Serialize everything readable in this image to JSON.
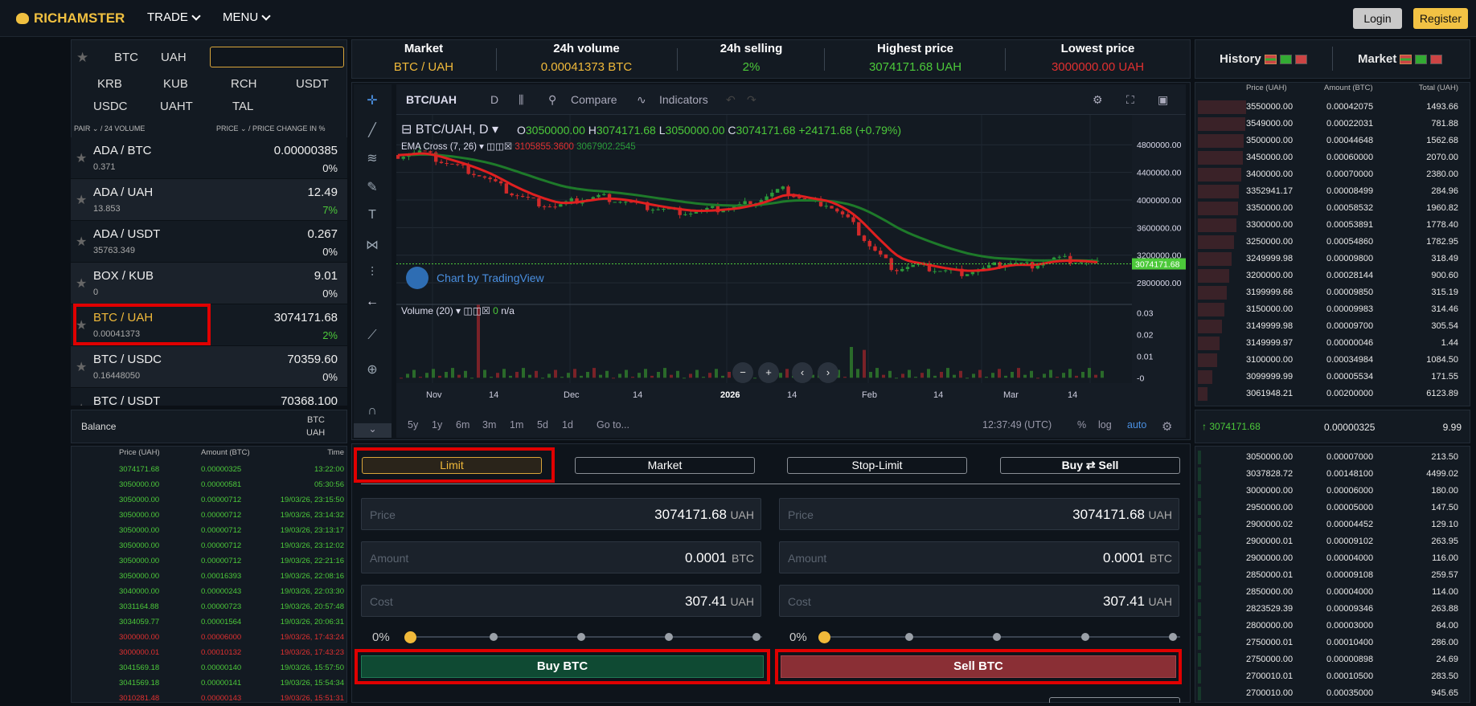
{
  "header": {
    "logo_text": "RICHAMSTER",
    "nav": [
      {
        "label": "TRADE"
      },
      {
        "label": "MENU"
      }
    ],
    "login_label": "Login",
    "register_label": "Register"
  },
  "currency_tabs": [
    "BTC",
    "UAH",
    "KRB",
    "KUB",
    "RCH",
    "USDT",
    "USDC",
    "UAHT",
    "TAL"
  ],
  "search": {
    "value": "",
    "placeholder": ""
  },
  "pairs_header": {
    "left": "PAIR ⌄ / 24 VOLUME",
    "right": "PRICE ⌄ / PRICE CHANGE IN %"
  },
  "pairs": [
    {
      "name": "ADA / BTC",
      "volume": "0.371",
      "price": "0.00000385",
      "change": "0%",
      "color": "#e8e8e8"
    },
    {
      "name": "ADA / UAH",
      "volume": "13.853",
      "price": "12.49",
      "change": "7%",
      "color": "#4cc93a"
    },
    {
      "name": "ADA / USDT",
      "volume": "35763.349",
      "price": "0.267",
      "change": "0%",
      "color": "#e8e8e8"
    },
    {
      "name": "BOX / KUB",
      "volume": "0",
      "price": "9.01",
      "change": "0%",
      "color": "#e8e8e8"
    },
    {
      "name": "BTC / UAH",
      "volume": "0.00041373",
      "price": "3074171.68",
      "change": "2%",
      "color": "#4cc93a"
    },
    {
      "name": "BTC / USDC",
      "volume": "0.16448050",
      "price": "70359.60",
      "change": "0%",
      "color": "#e8e8e8"
    },
    {
      "name": "BTC / USDT",
      "volume": "",
      "price": "70368.100",
      "change": "",
      "color": "#e8e8e8"
    }
  ],
  "balance": {
    "label": "Balance",
    "cur1": "BTC",
    "cur2": "UAH"
  },
  "trade_history": {
    "headers": [
      "Price (UAH)",
      "Amount (BTC)",
      "Time"
    ],
    "rows": [
      [
        "3074171.68",
        "0.00000325",
        "13:22:00",
        "g"
      ],
      [
        "3050000.00",
        "0.00000581",
        "05:30:56",
        "g"
      ],
      [
        "3050000.00",
        "0.00000712",
        "19/03/26, 23:15:50",
        "g"
      ],
      [
        "3050000.00",
        "0.00000712",
        "19/03/26, 23:14:32",
        "g"
      ],
      [
        "3050000.00",
        "0.00000712",
        "19/03/26, 23:13:17",
        "g"
      ],
      [
        "3050000.00",
        "0.00000712",
        "19/03/26, 23:12:02",
        "g"
      ],
      [
        "3050000.00",
        "0.00000712",
        "19/03/26, 22:21:16",
        "g"
      ],
      [
        "3050000.00",
        "0.00016393",
        "19/03/26, 22:08:16",
        "g"
      ],
      [
        "3040000.00",
        "0.00000243",
        "19/03/26, 22:03:30",
        "g"
      ],
      [
        "3031164.88",
        "0.00000723",
        "19/03/26, 20:57:48",
        "g"
      ],
      [
        "3034059.77",
        "0.00001564",
        "19/03/26, 20:06:31",
        "g"
      ],
      [
        "3000000.00",
        "0.00006000",
        "19/03/26, 17:43:24",
        "r"
      ],
      [
        "3000000.01",
        "0.00010132",
        "19/03/26, 17:43:23",
        "r"
      ],
      [
        "3041569.18",
        "0.00000140",
        "19/03/26, 15:57:50",
        "g"
      ],
      [
        "3041569.18",
        "0.00000141",
        "19/03/26, 15:54:34",
        "g"
      ],
      [
        "3010281.48",
        "0.00000143",
        "19/03/26, 15:51:31",
        "r"
      ]
    ]
  },
  "stats": [
    {
      "label": "Market",
      "value": "BTC / UAH",
      "color": "#f0b93a"
    },
    {
      "label": "24h volume",
      "value": "0.00041373 BTC",
      "color": "#f0b93a"
    },
    {
      "label": "24h selling",
      "value": "2%",
      "color": "#4cc93a"
    },
    {
      "label": "Highest price",
      "value": "3074171.68 UAH",
      "color": "#4cc93a"
    },
    {
      "label": "Lowest price",
      "value": "3000000.00 UAH",
      "color": "#e03030"
    }
  ],
  "chart_toolbar": {
    "symbol": "BTC/UAH",
    "interval": "D",
    "compare": "Compare",
    "indicators": "Indicators"
  },
  "chart_legend": {
    "symbol": "BTC/UAH, D",
    "open_label": "O",
    "open": "3050000.00",
    "high_label": "H",
    "high": "3074171.68",
    "low_label": "L",
    "low": "3050000.00",
    "close_label": "C",
    "close": "3074171.68",
    "change": "+24171.68 (+0.79%)",
    "ema_label": "EMA Cross (7, 26)",
    "ema1": "3105855.3600",
    "ema2": "3067902.2545",
    "watermark": "Chart by TradingView",
    "volume_label": "Volume (20)",
    "volume_val": "0",
    "volume_na": "n/a",
    "last_price": "3074171.68"
  },
  "chart_data": {
    "type": "candlestick",
    "title": "BTC/UAH, D",
    "y_ticks": [
      "4800000.00",
      "4400000.00",
      "4000000.00",
      "3600000.00",
      "3200000.00",
      "2800000.00"
    ],
    "y_tick_values": [
      4800000,
      4400000,
      4000000,
      3600000,
      3200000,
      2800000
    ],
    "ylim": [
      2580000,
      5000000
    ],
    "volume_ticks": [
      "0.03",
      "0.02",
      "0.01",
      "-0"
    ],
    "volume_tick_values": [
      0.03,
      0.02,
      0.01,
      0
    ],
    "volume_ylim": [
      -0.001,
      0.034
    ],
    "x_ticks": [
      "Nov",
      "14",
      "Dec",
      "14",
      "2026",
      "14",
      "Feb",
      "14",
      "Mar",
      "14"
    ],
    "close_approx": [
      4650000,
      4700000,
      4550000,
      4450000,
      4300000,
      4100000,
      3980000,
      3900000,
      4000000,
      4050000,
      3980000,
      3900000,
      3850000,
      3820000,
      3860000,
      3900000,
      4000000,
      4150000,
      4000000,
      3950000,
      3700000,
      3300000,
      3000000,
      3050000,
      2980000,
      2950000,
      3000000,
      3100000,
      3050000,
      3150000,
      3120000,
      3074171.68
    ],
    "last_price": 3074171.68
  },
  "chart_footer": {
    "ranges": [
      "5y",
      "1y",
      "6m",
      "3m",
      "1m",
      "5d",
      "1d"
    ],
    "goto": "Go to...",
    "time": "12:37:49 (UTC)",
    "pct": "%",
    "log": "log",
    "auto": "auto"
  },
  "order_tabs": [
    "Limit",
    "Market",
    "Stop-Limit"
  ],
  "buysell_toggle": {
    "buy": "Buy",
    "sell": "Sell"
  },
  "buy_form": {
    "price_ph": "Price",
    "price": "3074171.68",
    "price_unit": "UAH",
    "amount_ph": "Amount",
    "amount": "0.0001",
    "amount_unit": "BTC",
    "cost_ph": "Cost",
    "cost": "307.41",
    "cost_unit": "UAH",
    "percent": "0%",
    "button": "Buy BTC"
  },
  "sell_form": {
    "price_ph": "Price",
    "price": "3074171.68",
    "price_unit": "UAH",
    "amount_ph": "Amount",
    "amount": "0.0001",
    "amount_unit": "BTC",
    "cost_ph": "Cost",
    "cost": "307.41",
    "cost_unit": "UAH",
    "percent": "0%",
    "button": "Sell BTC"
  },
  "book_tabs": {
    "history": "History",
    "market": "Market"
  },
  "book_headers": [
    "Price (UAH)",
    "Amount (BTC)",
    "Total (UAH)"
  ],
  "asks": [
    [
      "3550000.00",
      "0.00042075",
      "1493.66",
      0.4
    ],
    [
      "3549000.00",
      "0.00022031",
      "781.88",
      0.39
    ],
    [
      "3500000.00",
      "0.00044648",
      "1562.68",
      0.38
    ],
    [
      "3450000.00",
      "0.00060000",
      "2070.00",
      0.37
    ],
    [
      "3400000.00",
      "0.00070000",
      "2380.00",
      0.36
    ],
    [
      "3352941.17",
      "0.00008499",
      "284.96",
      0.34
    ],
    [
      "3350000.00",
      "0.00058532",
      "1960.82",
      0.33
    ],
    [
      "3300000.00",
      "0.00053891",
      "1778.40",
      0.32
    ],
    [
      "3250000.00",
      "0.00054860",
      "1782.95",
      0.3
    ],
    [
      "3249999.98",
      "0.00009800",
      "318.49",
      0.28
    ],
    [
      "3200000.00",
      "0.00028144",
      "900.60",
      0.26
    ],
    [
      "3199999.66",
      "0.00009850",
      "315.19",
      0.24
    ],
    [
      "3150000.00",
      "0.00009983",
      "314.46",
      0.22
    ],
    [
      "3149999.98",
      "0.00009700",
      "305.54",
      0.2
    ],
    [
      "3149999.97",
      "0.00000046",
      "1.44",
      0.18
    ],
    [
      "3100000.00",
      "0.00034984",
      "1084.50",
      0.16
    ],
    [
      "3099999.99",
      "0.00005534",
      "171.55",
      0.12
    ],
    [
      "3061948.21",
      "0.00200000",
      "6123.89",
      0.08
    ]
  ],
  "last_trade": {
    "price": "3074171.68",
    "amount": "0.00000325",
    "total": "9.99"
  },
  "bids": [
    [
      "3050000.00",
      "0.00007000",
      "213.50"
    ],
    [
      "3037828.72",
      "0.00148100",
      "4499.02"
    ],
    [
      "3000000.00",
      "0.00006000",
      "180.00"
    ],
    [
      "2950000.00",
      "0.00005000",
      "147.50"
    ],
    [
      "2900000.02",
      "0.00004452",
      "129.10"
    ],
    [
      "2900000.01",
      "0.00009102",
      "263.95"
    ],
    [
      "2900000.00",
      "0.00004000",
      "116.00"
    ],
    [
      "2850000.01",
      "0.00009108",
      "259.57"
    ],
    [
      "2850000.00",
      "0.00004000",
      "114.00"
    ],
    [
      "2823529.39",
      "0.00009346",
      "263.88"
    ],
    [
      "2800000.00",
      "0.00003000",
      "84.00"
    ],
    [
      "2750000.01",
      "0.00010400",
      "286.00"
    ],
    [
      "2750000.00",
      "0.00000898",
      "24.69"
    ],
    [
      "2700010.01",
      "0.00010500",
      "283.50"
    ],
    [
      "2700010.00",
      "0.00035000",
      "945.65"
    ]
  ]
}
